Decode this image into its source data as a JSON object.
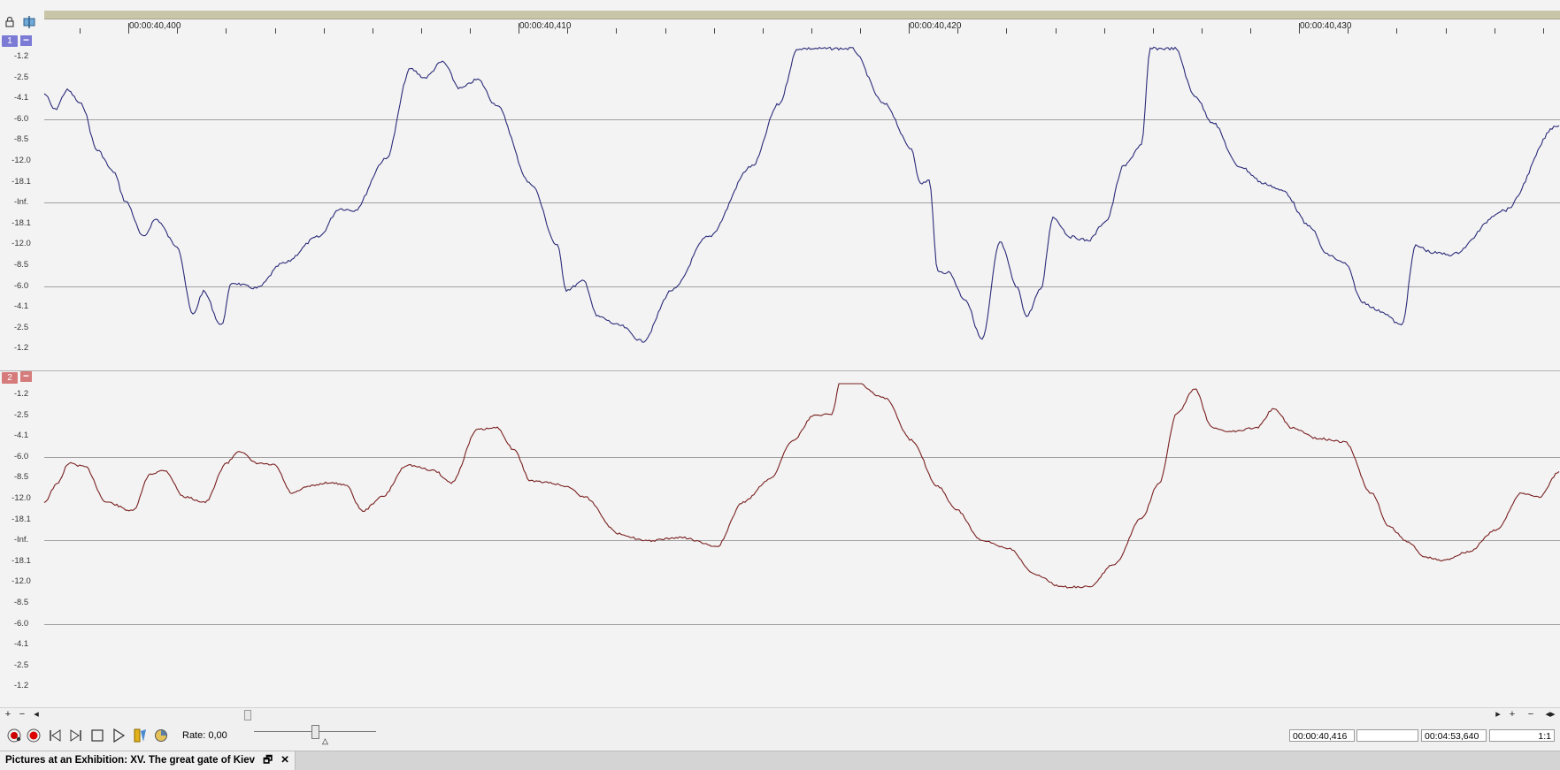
{
  "ruler": {
    "time_labels": [
      "00:00:40,400",
      "00:00:40,410",
      "00:00:40,420",
      "00:00:40,430"
    ]
  },
  "channels": [
    {
      "number": "1",
      "color": "#2b2b7a",
      "badge_color": "#7b7bd6",
      "db_labels": [
        "-1.2",
        "-2.5",
        "-4.1",
        "-6.0",
        "-8.5",
        "-12.0",
        "-18.1",
        "-Inf.",
        "-18.1",
        "-12.0",
        "-8.5",
        "-6.0",
        "-4.1",
        "-2.5",
        "-1.2"
      ]
    },
    {
      "number": "2",
      "color": "#7a2020",
      "badge_color": "#d67b7b",
      "db_labels": [
        "-1.2",
        "-2.5",
        "-4.1",
        "-6.0",
        "-8.5",
        "-12.0",
        "-18.1",
        "-Inf.",
        "-18.1",
        "-12.0",
        "-8.5",
        "-6.0",
        "-4.1",
        "-2.5",
        "-1.2"
      ]
    }
  ],
  "scrollbar": {
    "left_buttons": [
      "+",
      "−",
      "◂"
    ],
    "right_buttons": [
      "▸",
      "+",
      "−",
      "◂▸"
    ]
  },
  "transport": {
    "rate_label": "Rate: 0,00",
    "cursor_time": "00:00:40,416",
    "selection_field": "",
    "length": "00:04:53,640",
    "zoom": "1:1"
  },
  "status": {
    "document_title": "Pictures at an Exhibition: XV. The great gate of Kiev",
    "restore_glyph": "🗗",
    "close_glyph": "✕"
  }
}
